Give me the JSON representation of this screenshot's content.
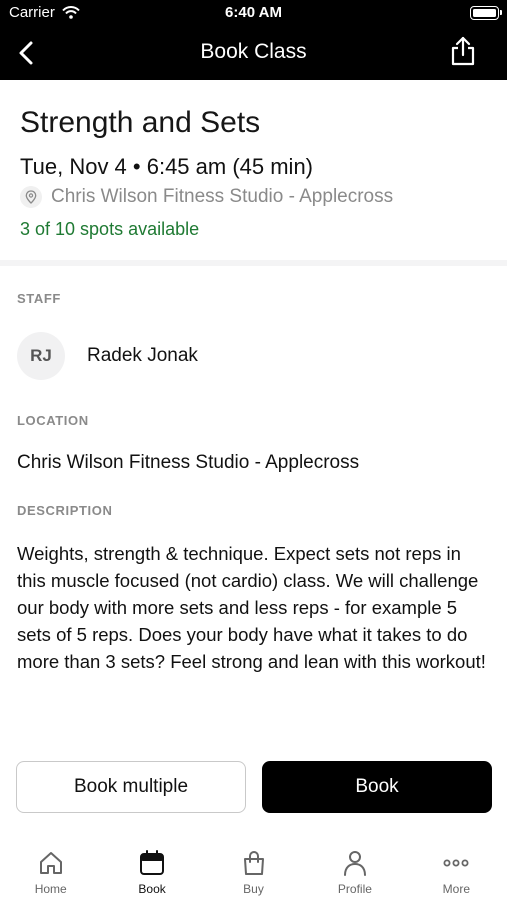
{
  "status_bar": {
    "carrier": "Carrier",
    "time": "6:40 AM"
  },
  "nav": {
    "title": "Book Class",
    "back_icon": "chevron-left-icon",
    "share_icon": "share-icon"
  },
  "class": {
    "name": "Strength and Sets",
    "when": "Tue, Nov 4 • 6:45 am (45 min)",
    "location": "Chris Wilson Fitness Studio - Applecross",
    "spots": "3 of 10 spots available"
  },
  "staff": {
    "label": "STAFF",
    "initials": "RJ",
    "name": "Radek Jonak"
  },
  "location_section": {
    "label": "LOCATION",
    "value": "Chris Wilson Fitness Studio - Applecross"
  },
  "description_section": {
    "label": "DESCRIPTION",
    "text": "Weights, strength & technique. Expect sets not reps in this muscle focused (not cardio) class. We will challenge our body with more sets and less reps - for example 5 sets of 5 reps. Does your body have what it takes to do more than 3 sets? Feel strong and lean with this workout!"
  },
  "actions": {
    "book_multiple": "Book multiple",
    "book": "Book"
  },
  "tabs": [
    {
      "label": "Home",
      "icon": "home-icon"
    },
    {
      "label": "Book",
      "icon": "calendar-icon",
      "active": true
    },
    {
      "label": "Buy",
      "icon": "shopping-bag-icon"
    },
    {
      "label": "Profile",
      "icon": "person-icon"
    },
    {
      "label": "More",
      "icon": "more-dots-icon"
    }
  ],
  "colors": {
    "accent": "#000000",
    "available": "#1f7a33",
    "muted": "#8a8a8a"
  }
}
